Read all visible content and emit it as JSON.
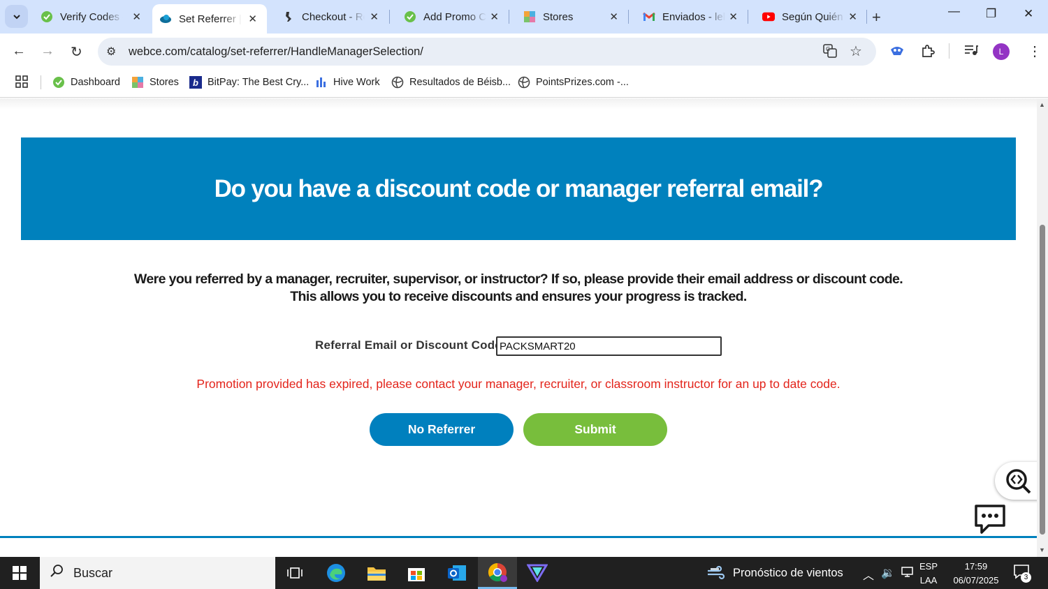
{
  "browser": {
    "tabs": [
      {
        "title": "Verify Codes – ",
        "icon": "green-check-icon"
      },
      {
        "title": "Set Referrer | W",
        "icon": "webce-icon",
        "active": true
      },
      {
        "title": "Checkout - Ro",
        "icon": "shoe-icon"
      },
      {
        "title": "Add Promo Co",
        "icon": "green-check-icon"
      },
      {
        "title": "Stores",
        "icon": "stores-icon"
      },
      {
        "title": "Enviados - lelc",
        "icon": "gmail-icon"
      },
      {
        "title": "Según Quién ",
        "icon": "youtube-icon"
      }
    ],
    "url": "webce.com/catalog/set-referrer/HandleManagerSelection/",
    "avatar_letter": "L",
    "bookmarks": [
      {
        "label": "Dashboard"
      },
      {
        "label": "Stores"
      },
      {
        "label": "BitPay: The Best Cry..."
      },
      {
        "label": "Hive Work"
      },
      {
        "label": "Resultados de Béisb..."
      },
      {
        "label": "PointsPrizes.com -..."
      }
    ]
  },
  "page": {
    "heading": "Do you have a discount code or manager referral email?",
    "intro_line1": "Were you referred by a manager, recruiter, supervisor, or instructor? If so, please provide their email address or discount code.",
    "intro_line2": "This allows you to receive discounts and ensures your progress is tracked.",
    "field_label": "Referral Email or Discount Code:",
    "field_value": "PACKSMART20",
    "error": "Promotion provided has expired, please contact your manager, recruiter, or classroom instructor for an up to date code.",
    "no_referrer_button": "No Referrer",
    "submit_button": "Submit",
    "colors": {
      "brand_blue": "#0081bd",
      "submit_green": "#78be3c",
      "error_red": "#e3241b"
    }
  },
  "taskbar": {
    "search_placeholder": "Buscar",
    "weather": "Pronóstico de vientos",
    "lang_top": "ESP",
    "lang_bottom": "LAA",
    "time": "17:59",
    "date": "06/07/2025",
    "notifications": "3"
  }
}
